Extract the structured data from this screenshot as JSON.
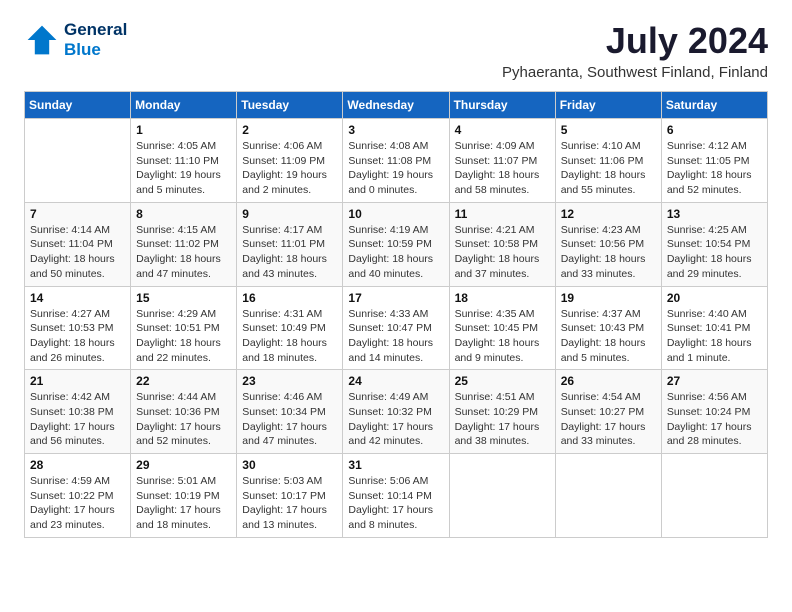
{
  "header": {
    "logo_line1": "General",
    "logo_line2": "Blue",
    "month": "July 2024",
    "location": "Pyhaeranta, Southwest Finland, Finland"
  },
  "weekdays": [
    "Sunday",
    "Monday",
    "Tuesday",
    "Wednesday",
    "Thursday",
    "Friday",
    "Saturday"
  ],
  "weeks": [
    [
      {
        "day": "",
        "sunrise": "",
        "sunset": "",
        "daylight": ""
      },
      {
        "day": "1",
        "sunrise": "Sunrise: 4:05 AM",
        "sunset": "Sunset: 11:10 PM",
        "daylight": "Daylight: 19 hours and 5 minutes."
      },
      {
        "day": "2",
        "sunrise": "Sunrise: 4:06 AM",
        "sunset": "Sunset: 11:09 PM",
        "daylight": "Daylight: 19 hours and 2 minutes."
      },
      {
        "day": "3",
        "sunrise": "Sunrise: 4:08 AM",
        "sunset": "Sunset: 11:08 PM",
        "daylight": "Daylight: 19 hours and 0 minutes."
      },
      {
        "day": "4",
        "sunrise": "Sunrise: 4:09 AM",
        "sunset": "Sunset: 11:07 PM",
        "daylight": "Daylight: 18 hours and 58 minutes."
      },
      {
        "day": "5",
        "sunrise": "Sunrise: 4:10 AM",
        "sunset": "Sunset: 11:06 PM",
        "daylight": "Daylight: 18 hours and 55 minutes."
      },
      {
        "day": "6",
        "sunrise": "Sunrise: 4:12 AM",
        "sunset": "Sunset: 11:05 PM",
        "daylight": "Daylight: 18 hours and 52 minutes."
      }
    ],
    [
      {
        "day": "7",
        "sunrise": "Sunrise: 4:14 AM",
        "sunset": "Sunset: 11:04 PM",
        "daylight": "Daylight: 18 hours and 50 minutes."
      },
      {
        "day": "8",
        "sunrise": "Sunrise: 4:15 AM",
        "sunset": "Sunset: 11:02 PM",
        "daylight": "Daylight: 18 hours and 47 minutes."
      },
      {
        "day": "9",
        "sunrise": "Sunrise: 4:17 AM",
        "sunset": "Sunset: 11:01 PM",
        "daylight": "Daylight: 18 hours and 43 minutes."
      },
      {
        "day": "10",
        "sunrise": "Sunrise: 4:19 AM",
        "sunset": "Sunset: 10:59 PM",
        "daylight": "Daylight: 18 hours and 40 minutes."
      },
      {
        "day": "11",
        "sunrise": "Sunrise: 4:21 AM",
        "sunset": "Sunset: 10:58 PM",
        "daylight": "Daylight: 18 hours and 37 minutes."
      },
      {
        "day": "12",
        "sunrise": "Sunrise: 4:23 AM",
        "sunset": "Sunset: 10:56 PM",
        "daylight": "Daylight: 18 hours and 33 minutes."
      },
      {
        "day": "13",
        "sunrise": "Sunrise: 4:25 AM",
        "sunset": "Sunset: 10:54 PM",
        "daylight": "Daylight: 18 hours and 29 minutes."
      }
    ],
    [
      {
        "day": "14",
        "sunrise": "Sunrise: 4:27 AM",
        "sunset": "Sunset: 10:53 PM",
        "daylight": "Daylight: 18 hours and 26 minutes."
      },
      {
        "day": "15",
        "sunrise": "Sunrise: 4:29 AM",
        "sunset": "Sunset: 10:51 PM",
        "daylight": "Daylight: 18 hours and 22 minutes."
      },
      {
        "day": "16",
        "sunrise": "Sunrise: 4:31 AM",
        "sunset": "Sunset: 10:49 PM",
        "daylight": "Daylight: 18 hours and 18 minutes."
      },
      {
        "day": "17",
        "sunrise": "Sunrise: 4:33 AM",
        "sunset": "Sunset: 10:47 PM",
        "daylight": "Daylight: 18 hours and 14 minutes."
      },
      {
        "day": "18",
        "sunrise": "Sunrise: 4:35 AM",
        "sunset": "Sunset: 10:45 PM",
        "daylight": "Daylight: 18 hours and 9 minutes."
      },
      {
        "day": "19",
        "sunrise": "Sunrise: 4:37 AM",
        "sunset": "Sunset: 10:43 PM",
        "daylight": "Daylight: 18 hours and 5 minutes."
      },
      {
        "day": "20",
        "sunrise": "Sunrise: 4:40 AM",
        "sunset": "Sunset: 10:41 PM",
        "daylight": "Daylight: 18 hours and 1 minute."
      }
    ],
    [
      {
        "day": "21",
        "sunrise": "Sunrise: 4:42 AM",
        "sunset": "Sunset: 10:38 PM",
        "daylight": "Daylight: 17 hours and 56 minutes."
      },
      {
        "day": "22",
        "sunrise": "Sunrise: 4:44 AM",
        "sunset": "Sunset: 10:36 PM",
        "daylight": "Daylight: 17 hours and 52 minutes."
      },
      {
        "day": "23",
        "sunrise": "Sunrise: 4:46 AM",
        "sunset": "Sunset: 10:34 PM",
        "daylight": "Daylight: 17 hours and 47 minutes."
      },
      {
        "day": "24",
        "sunrise": "Sunrise: 4:49 AM",
        "sunset": "Sunset: 10:32 PM",
        "daylight": "Daylight: 17 hours and 42 minutes."
      },
      {
        "day": "25",
        "sunrise": "Sunrise: 4:51 AM",
        "sunset": "Sunset: 10:29 PM",
        "daylight": "Daylight: 17 hours and 38 minutes."
      },
      {
        "day": "26",
        "sunrise": "Sunrise: 4:54 AM",
        "sunset": "Sunset: 10:27 PM",
        "daylight": "Daylight: 17 hours and 33 minutes."
      },
      {
        "day": "27",
        "sunrise": "Sunrise: 4:56 AM",
        "sunset": "Sunset: 10:24 PM",
        "daylight": "Daylight: 17 hours and 28 minutes."
      }
    ],
    [
      {
        "day": "28",
        "sunrise": "Sunrise: 4:59 AM",
        "sunset": "Sunset: 10:22 PM",
        "daylight": "Daylight: 17 hours and 23 minutes."
      },
      {
        "day": "29",
        "sunrise": "Sunrise: 5:01 AM",
        "sunset": "Sunset: 10:19 PM",
        "daylight": "Daylight: 17 hours and 18 minutes."
      },
      {
        "day": "30",
        "sunrise": "Sunrise: 5:03 AM",
        "sunset": "Sunset: 10:17 PM",
        "daylight": "Daylight: 17 hours and 13 minutes."
      },
      {
        "day": "31",
        "sunrise": "Sunrise: 5:06 AM",
        "sunset": "Sunset: 10:14 PM",
        "daylight": "Daylight: 17 hours and 8 minutes."
      },
      {
        "day": "",
        "sunrise": "",
        "sunset": "",
        "daylight": ""
      },
      {
        "day": "",
        "sunrise": "",
        "sunset": "",
        "daylight": ""
      },
      {
        "day": "",
        "sunrise": "",
        "sunset": "",
        "daylight": ""
      }
    ]
  ]
}
